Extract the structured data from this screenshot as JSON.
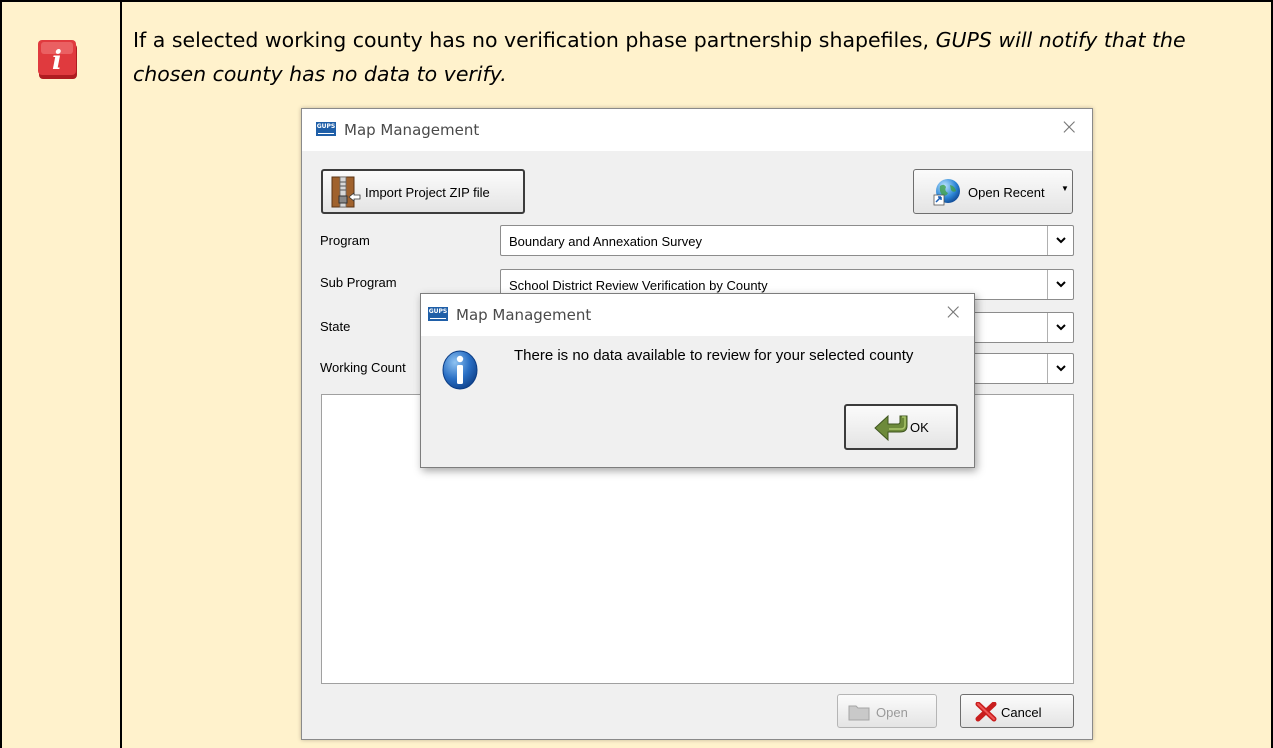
{
  "note": {
    "text_normal": "If a selected working county has no verification phase partnership shapefiles, ",
    "text_italic": "GUPS will notify that the chosen county has no data to verify.",
    "icon": "info-icon"
  },
  "main_window": {
    "logo_text": "GUPS",
    "title": "Map Management",
    "close_glyph": "×",
    "import_button": "Import Project ZIP file",
    "recent_button": "Open Recent",
    "fields": {
      "program_label": "Program",
      "program_value": "Boundary and Annexation Survey",
      "subprogram_label": "Sub Program",
      "subprogram_value": "School District Review Verification by County",
      "state_label": "State",
      "county_label": "Working Count"
    },
    "open_button": "Open",
    "cancel_button": "Cancel"
  },
  "modal": {
    "logo_text": "GUPS",
    "title": "Map Management",
    "close_glyph": "×",
    "message": "There is no data available to review for your selected county",
    "ok_button": "OK"
  },
  "colors": {
    "note_background": "#fff2cc",
    "logo_blue": "#1f5fa8",
    "info_red": "#d9262b"
  }
}
